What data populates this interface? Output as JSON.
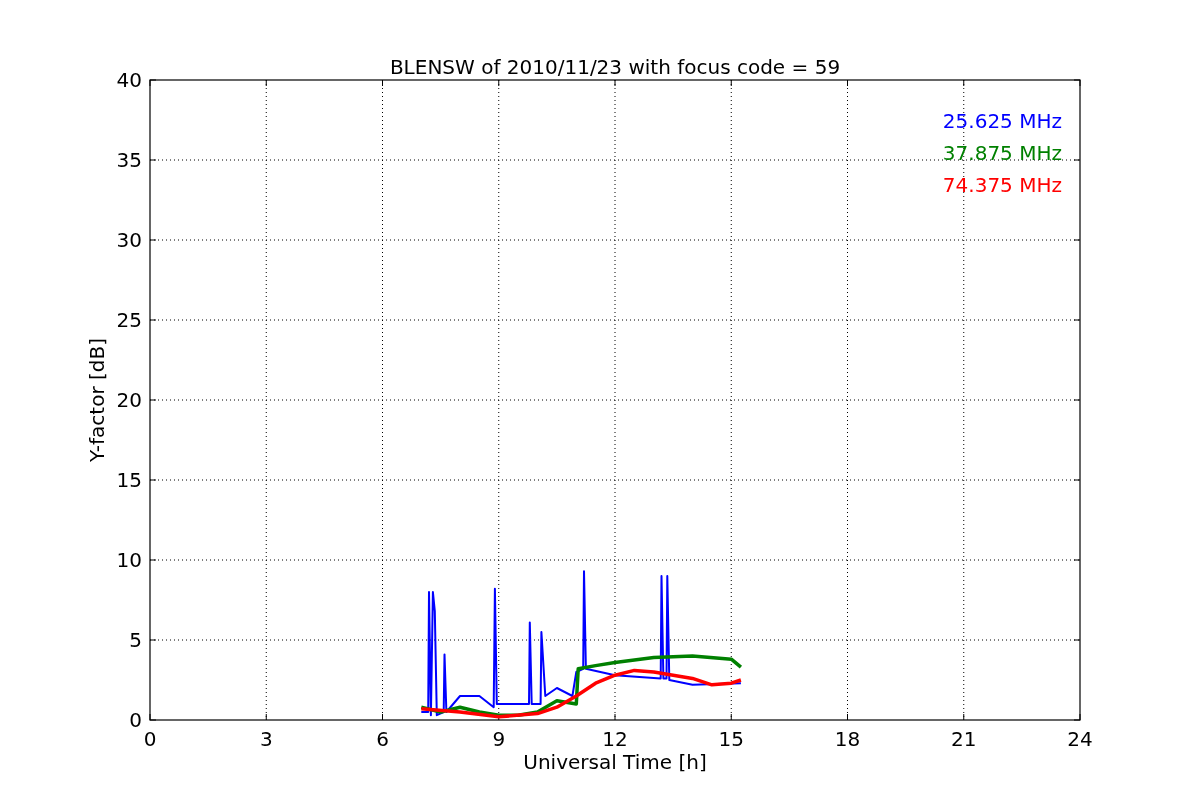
{
  "figure": {
    "chart_data": {
      "type": "line",
      "grid": true,
      "title": "BLENSW of 2010/11/23 with focus code = 59",
      "xlabel": "Universal Time [h]",
      "ylabel": "Y-factor [dB]",
      "xlim": [
        0,
        24
      ],
      "ylim": [
        0,
        40
      ],
      "xticks": [
        0,
        3,
        6,
        9,
        12,
        15,
        18,
        21,
        24
      ],
      "yticks": [
        0,
        5,
        10,
        15,
        20,
        25,
        30,
        35,
        40
      ],
      "series": [
        {
          "name": "25.625 MHz",
          "color": "#0000ff",
          "x": [
            7.0,
            7.18,
            7.2,
            7.25,
            7.3,
            7.35,
            7.4,
            7.58,
            7.6,
            7.65,
            8.0,
            8.5,
            8.87,
            8.9,
            8.95,
            9.5,
            9.78,
            9.8,
            9.85,
            10.08,
            10.1,
            10.2,
            10.5,
            10.9,
            11.0,
            11.18,
            11.2,
            11.25,
            12.0,
            13.18,
            13.2,
            13.25,
            13.33,
            13.35,
            13.4,
            14.0,
            15.25
          ],
          "values": [
            0.5,
            0.5,
            8.0,
            0.3,
            8.0,
            6.8,
            0.3,
            0.5,
            4.1,
            0.5,
            1.5,
            1.5,
            0.8,
            8.2,
            1.0,
            1.0,
            1.0,
            6.1,
            1.0,
            1.0,
            5.5,
            1.5,
            2.0,
            1.5,
            3.0,
            3.2,
            9.3,
            3.2,
            2.8,
            2.6,
            9.0,
            2.6,
            2.6,
            9.0,
            2.5,
            2.2,
            2.3
          ]
        },
        {
          "name": "37.875 MHz",
          "color": "#008000",
          "x": [
            7.0,
            7.5,
            8.0,
            8.5,
            9.0,
            9.5,
            10.0,
            10.5,
            11.0,
            11.05,
            11.5,
            12.0,
            13.0,
            14.0,
            15.0,
            15.25
          ],
          "values": [
            0.8,
            0.5,
            0.8,
            0.5,
            0.3,
            0.3,
            0.5,
            1.2,
            1.0,
            3.2,
            3.4,
            3.6,
            3.9,
            4.0,
            3.8,
            3.3
          ]
        },
        {
          "name": "74.375 MHz",
          "color": "#ff0000",
          "x": [
            7.0,
            8.0,
            9.0,
            10.0,
            10.5,
            11.0,
            11.5,
            12.0,
            12.5,
            13.0,
            14.0,
            14.5,
            15.0,
            15.25
          ],
          "values": [
            0.7,
            0.5,
            0.2,
            0.4,
            0.8,
            1.5,
            2.3,
            2.8,
            3.1,
            3.0,
            2.6,
            2.2,
            2.3,
            2.5
          ]
        }
      ]
    }
  }
}
